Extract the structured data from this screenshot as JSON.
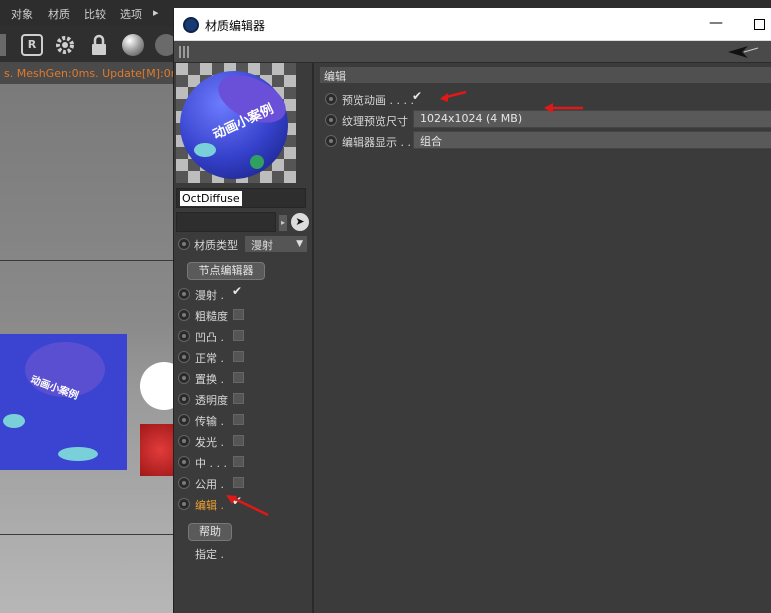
{
  "background_app": {
    "menu": [
      "对象",
      "材质",
      "比较",
      "选项",
      "▸"
    ],
    "status_text": "s. MeshGen:0ms. Update[M]:0ms. ",
    "toolbar_letter": "R"
  },
  "editor": {
    "title": "材质编辑器",
    "minimize": "—",
    "material_name": "OctDiffuse",
    "type_label": "材质类型",
    "type_value": "漫射",
    "node_editor_button": "节点编辑器",
    "help_button": "帮助",
    "assign_label": "指定 .",
    "channels": [
      {
        "label": "漫射 .",
        "checked": true
      },
      {
        "label": "粗糙度",
        "checked": false
      },
      {
        "label": "凹凸 .",
        "checked": false
      },
      {
        "label": "正常 .",
        "checked": false
      },
      {
        "label": "置换 .",
        "checked": false
      },
      {
        "label": "透明度",
        "checked": false
      },
      {
        "label": "传输 .",
        "checked": false
      },
      {
        "label": "发光 .",
        "checked": false
      },
      {
        "label": "中 . . .",
        "checked": false
      },
      {
        "label": "公用 .",
        "checked": false
      },
      {
        "label": "编辑 .",
        "checked": true,
        "active": true
      }
    ],
    "right": {
      "section_title": "编辑",
      "preview_anim_label": "预览动画 . . . .",
      "preview_anim_checked": "✔",
      "texture_preview_label": "纹理预览尺寸",
      "texture_preview_value": "1024x1024 (4 MB)",
      "editor_display_label": "编辑器显示 . .",
      "editor_display_value": "组合"
    },
    "preview_text": "动画小案例"
  },
  "colors": {
    "accent_orange": "#f0a030",
    "annotation_red": "#e01818",
    "status_orange": "#e07a2c"
  }
}
